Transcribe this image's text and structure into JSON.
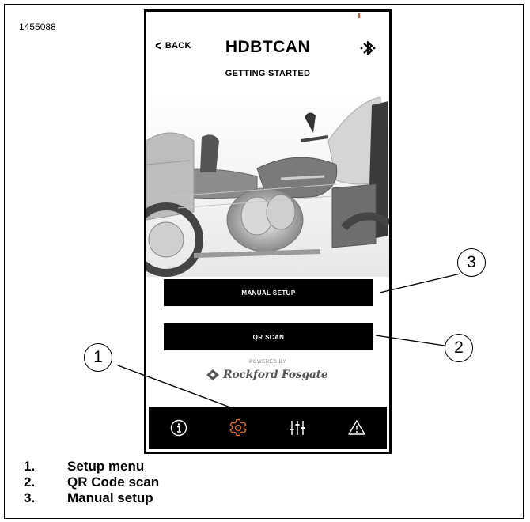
{
  "figure_id": "1455088",
  "app": {
    "back_label": "BACK",
    "title": "HDBTCAN",
    "subtitle": "GETTING STARTED",
    "bluetooth_icon": "bluetooth-icon"
  },
  "buttons": {
    "manual_setup": "MANUAL SETUP",
    "qr_scan": "QR SCAN"
  },
  "branding": {
    "powered_by": "POWERED BY",
    "brand_name": "Rockford Fosgate"
  },
  "tabbar": {
    "items": [
      {
        "icon": "info-icon",
        "active": false
      },
      {
        "icon": "gear-icon",
        "active": true
      },
      {
        "icon": "sliders-icon",
        "active": false
      },
      {
        "icon": "warning-icon",
        "active": false
      }
    ],
    "active_color": "#e8742c",
    "inactive_color": "#ffffff"
  },
  "callouts": [
    "1",
    "2",
    "3"
  ],
  "legend": [
    {
      "num": "1.",
      "label": "Setup menu"
    },
    {
      "num": "2.",
      "label": "QR Code scan"
    },
    {
      "num": "3.",
      "label": "Manual setup"
    }
  ]
}
